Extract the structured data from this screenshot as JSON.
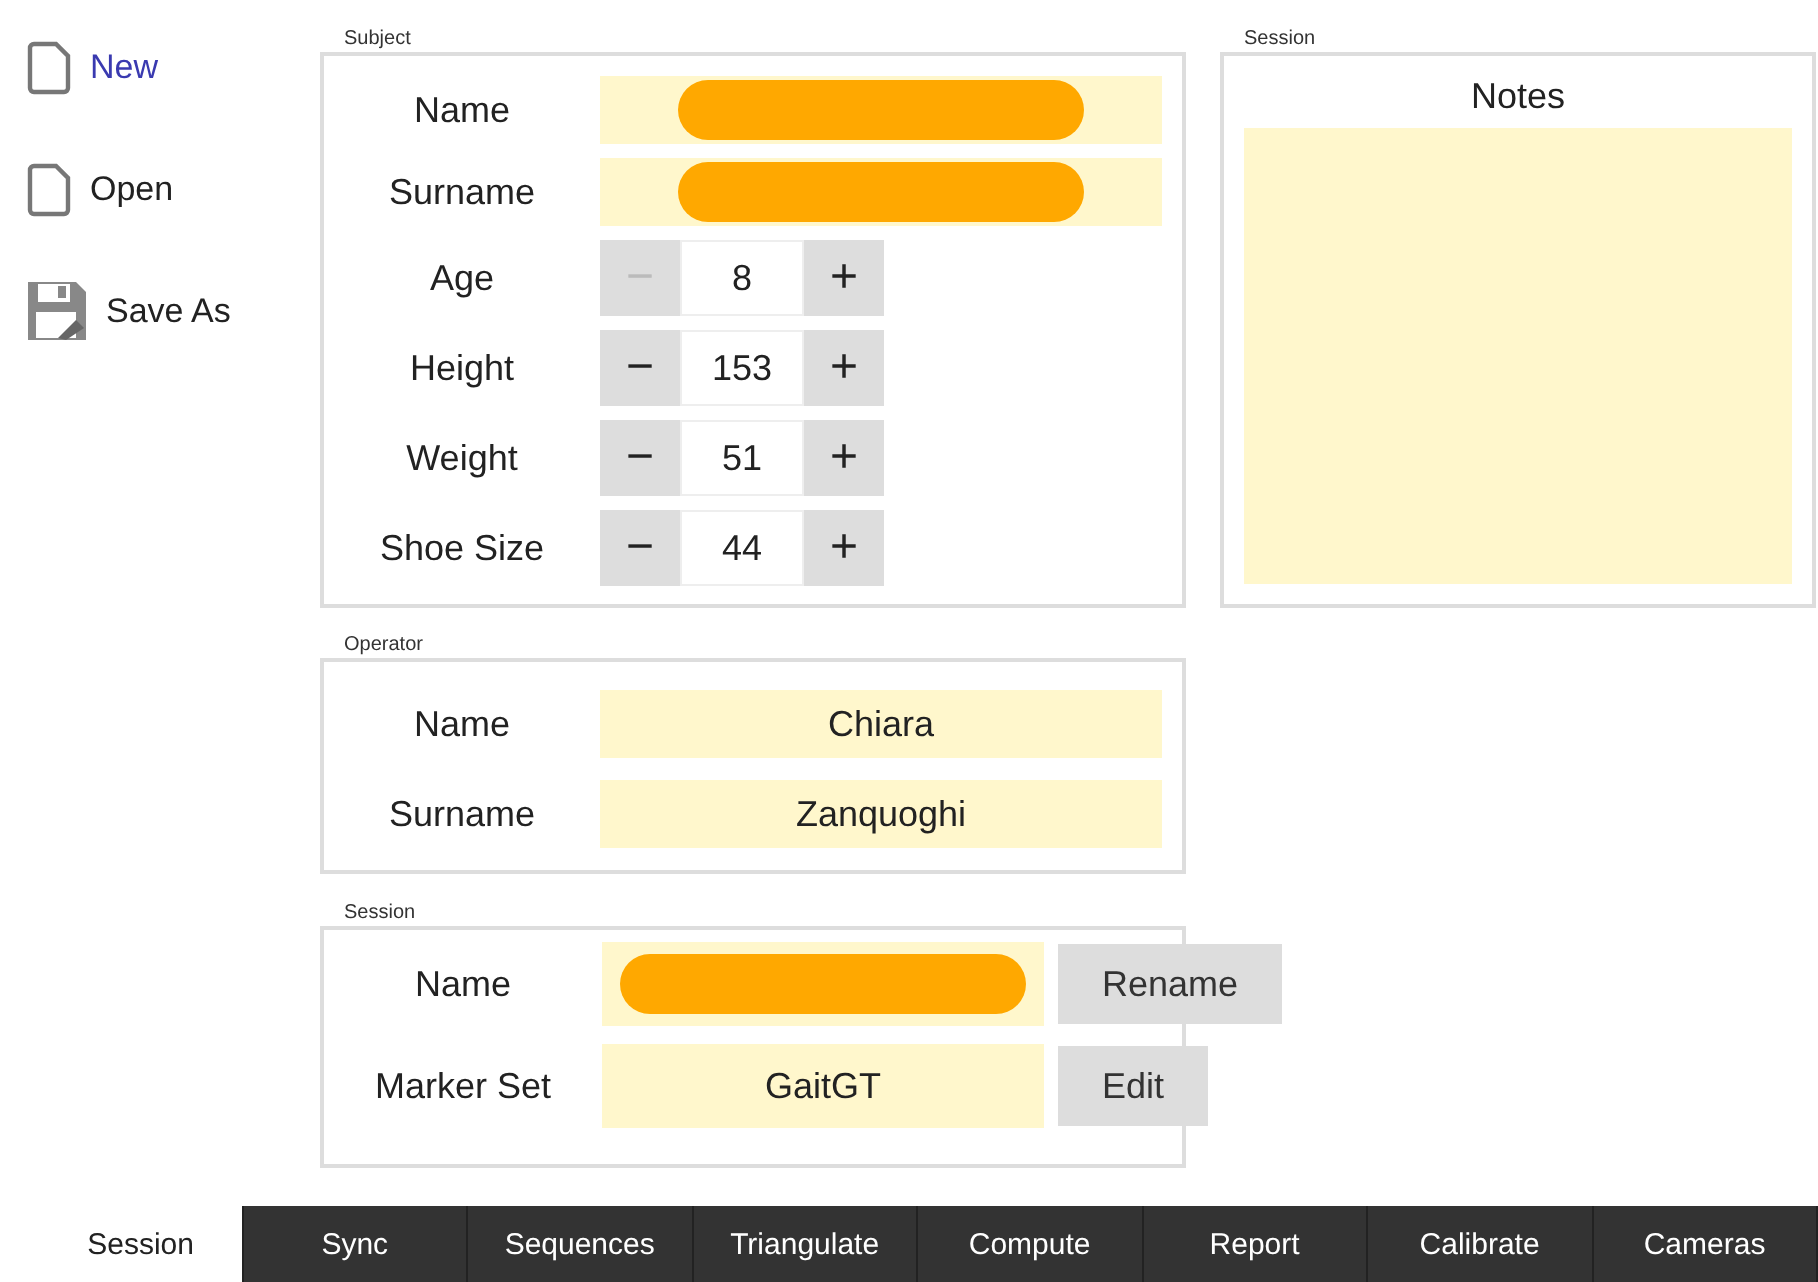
{
  "sidebar": {
    "items": [
      {
        "label": "New",
        "kind": "page",
        "selected": true
      },
      {
        "label": "Open",
        "kind": "page",
        "selected": false
      },
      {
        "label": "Save As",
        "kind": "disk",
        "selected": false
      }
    ]
  },
  "subject": {
    "title": "Subject",
    "fields": [
      {
        "kind": "text",
        "label": "Name",
        "redacted": true
      },
      {
        "kind": "text",
        "label": "Surname",
        "redacted": true
      },
      {
        "kind": "stepper",
        "label": "Age",
        "minus": "−",
        "value": "8",
        "plus": "+",
        "minus_disabled": true
      },
      {
        "kind": "stepper",
        "label": "Height",
        "minus": "−",
        "value": "153",
        "plus": "+",
        "minus_disabled": false
      },
      {
        "kind": "stepper",
        "label": "Weight",
        "minus": "−",
        "value": "51",
        "plus": "+",
        "minus_disabled": false
      },
      {
        "kind": "stepper",
        "label": "Shoe Size",
        "minus": "−",
        "value": "44",
        "plus": "+",
        "minus_disabled": false
      }
    ]
  },
  "notes_panel": {
    "title": "Session",
    "heading": "Notes"
  },
  "operator": {
    "title": "Operator",
    "fields": [
      {
        "kind": "text",
        "label": "Name",
        "value": "Chiara",
        "redacted": false
      },
      {
        "kind": "text",
        "label": "Surname",
        "value": "Zanquoghi",
        "redacted": false
      }
    ]
  },
  "session": {
    "title": "Session",
    "fields": [
      {
        "kind": "text",
        "label": "Name",
        "redacted": true,
        "button": "Rename"
      },
      {
        "kind": "text",
        "label": "Marker Set",
        "value": "GaitGT",
        "redacted": false,
        "button": "Edit"
      }
    ]
  },
  "tabs": [
    {
      "label": "Session",
      "selected": true
    },
    {
      "label": "Sync",
      "selected": false
    },
    {
      "label": "Sequences",
      "selected": false
    },
    {
      "label": "Triangulate",
      "selected": false
    },
    {
      "label": "Compute",
      "selected": false
    },
    {
      "label": "Report",
      "selected": false
    },
    {
      "label": "Calibrate",
      "selected": false
    },
    {
      "label": "Cameras",
      "selected": false
    }
  ]
}
